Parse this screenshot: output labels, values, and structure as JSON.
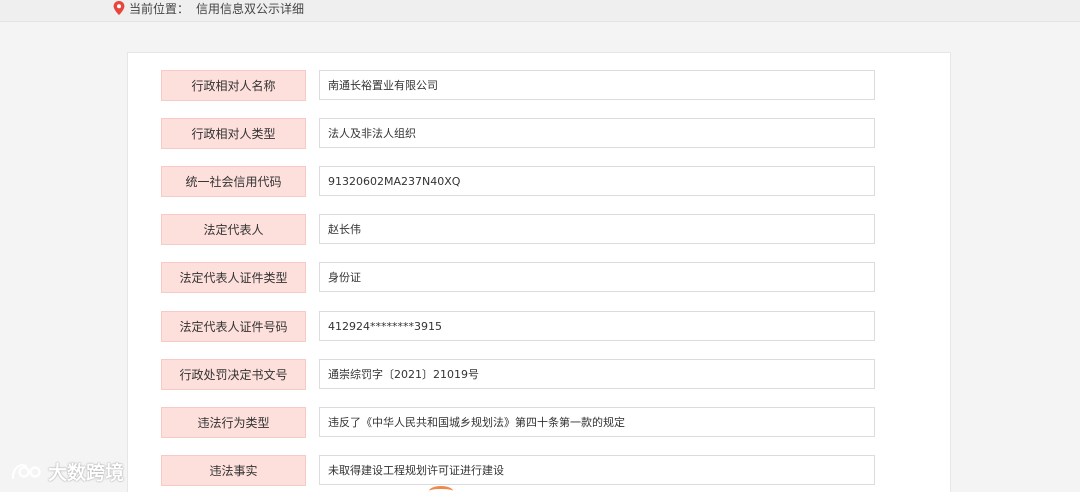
{
  "breadcrumb": {
    "prefix": "当前位置：",
    "current": "信用信息双公示详细"
  },
  "fields": [
    {
      "label": "行政相对人名称",
      "value": "南通长裕置业有限公司"
    },
    {
      "label": "行政相对人类型",
      "value": "法人及非法人组织"
    },
    {
      "label": "统一社会信用代码",
      "value": "91320602MA237N40XQ"
    },
    {
      "label": "法定代表人",
      "value": "赵长伟"
    },
    {
      "label": "法定代表人证件类型",
      "value": "身份证"
    },
    {
      "label": "法定代表人证件号码",
      "value": "412924********3915"
    },
    {
      "label": "行政处罚决定书文号",
      "value": "通崇综罚字〔2021〕21019号"
    },
    {
      "label": "违法行为类型",
      "value": "违反了《中华人民共和国城乡规划法》第四十条第一款的规定"
    },
    {
      "label": "违法事实",
      "value": "未取得建设工程规划许可证进行建设"
    }
  ],
  "watermark": {
    "text": "大数跨境"
  },
  "colors": {
    "label_bg": "#fde0dc",
    "pin": "#e8453c"
  }
}
